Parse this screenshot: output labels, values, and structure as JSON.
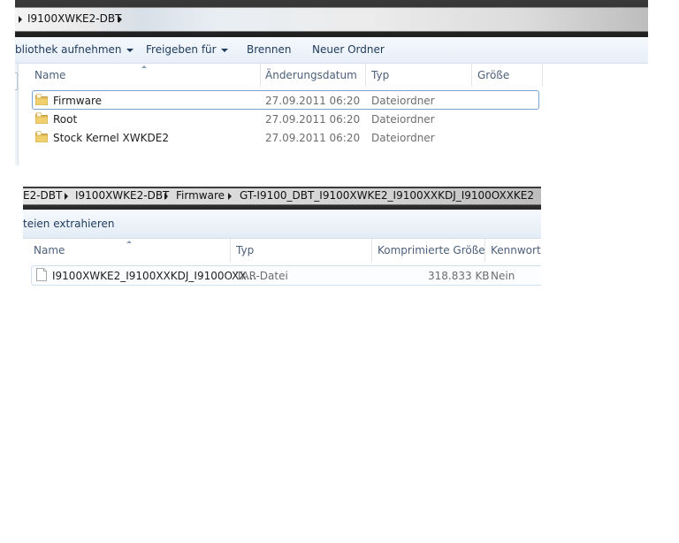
{
  "panel1": {
    "breadcrumb": [
      "I9100XWKE2-DBT"
    ],
    "toolbar": [
      "bliothek aufnehmen",
      "Freigeben für",
      "Brennen",
      "Neuer Ordner"
    ],
    "columns": [
      "Name",
      "Änderungsdatum",
      "Typ",
      "Größe"
    ],
    "rows": [
      {
        "name": "Firmware",
        "date": "27.09.2011 06:20",
        "type": "Dateiordner",
        "icon": "folder-icon"
      },
      {
        "name": "Root",
        "date": "27.09.2011 06:20",
        "type": "Dateiordner",
        "icon": "folder-icon"
      },
      {
        "name": "Stock Kernel XWKDE2",
        "date": "27.09.2011 06:20",
        "type": "Dateiordner",
        "icon": "folder-icon"
      }
    ],
    "selected_row": "Firmware"
  },
  "panel2": {
    "breadcrumb": [
      "E2-DBT",
      "I9100XWKE2-DBT",
      "Firmware",
      "GT-I9100_DBT_I9100XWKE2_I9100XXKDJ_I9100OXXKE2"
    ],
    "toolbar": [
      "teien extrahieren"
    ],
    "columns": [
      "Name",
      "Typ",
      "Komprimierte Größe",
      "Kennwortg"
    ],
    "rows": [
      {
        "name": "I9100XWKE2_I9100XXKDJ_I9100OXX...",
        "type": "TAR-Datei",
        "size": "318.833 KB",
        "protected": "Nein",
        "icon": "file-icon"
      }
    ]
  },
  "colors": {
    "selection_border": "#7da2ce",
    "folder_yellow": "#e8c15a",
    "toolbar_text": "#1e395b"
  }
}
